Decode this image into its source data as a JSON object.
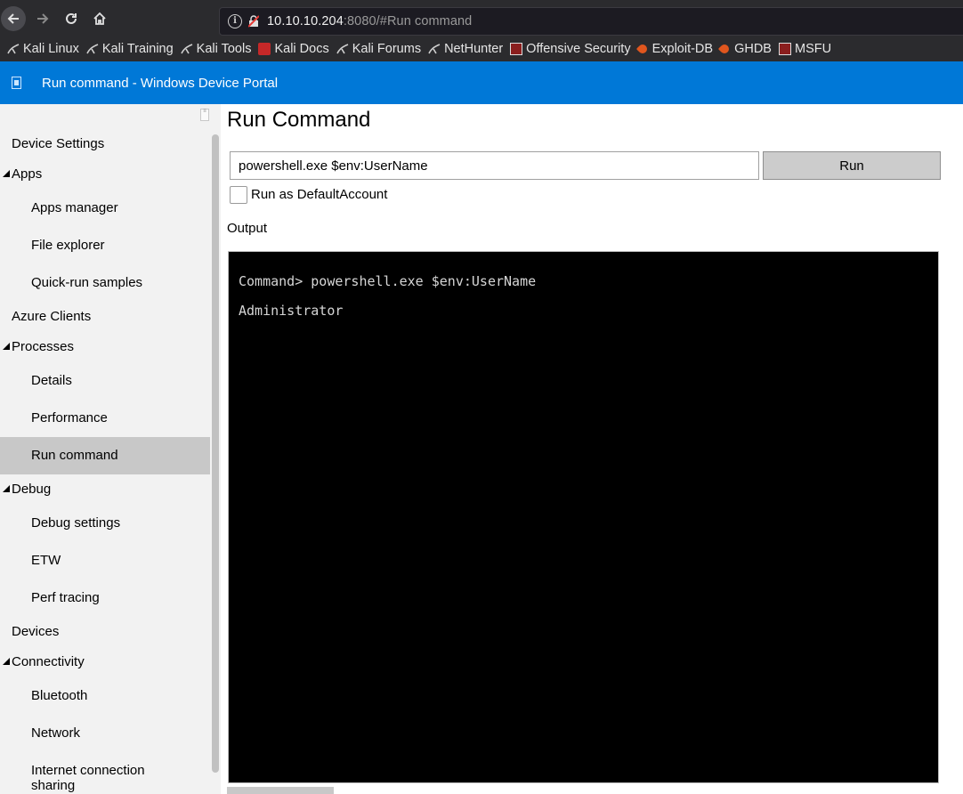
{
  "browser": {
    "url_host": "10.10.10.204",
    "url_rest": ":8080/#Run command",
    "bookmarks": [
      {
        "label": "Kali Linux",
        "icon": "kali-dragon-icon"
      },
      {
        "label": "Kali Training",
        "icon": "kali-dragon-icon"
      },
      {
        "label": "Kali Tools",
        "icon": "kali-dragon-icon"
      },
      {
        "label": "Kali Docs",
        "icon": "kali-docs-icon"
      },
      {
        "label": "Kali Forums",
        "icon": "kali-dragon-icon"
      },
      {
        "label": "NetHunter",
        "icon": "kali-dragon-icon"
      },
      {
        "label": "Offensive Security",
        "icon": "offsec-icon"
      },
      {
        "label": "Exploit-DB",
        "icon": "exploitdb-icon"
      },
      {
        "label": "GHDB",
        "icon": "exploitdb-icon"
      },
      {
        "label": "MSFU",
        "icon": "offsec-icon"
      }
    ]
  },
  "header": {
    "title": "Run command - Windows Device Portal",
    "color": "#0078d7"
  },
  "sidebar": {
    "items": [
      {
        "label": "Device Settings",
        "kind": "top"
      },
      {
        "label": "Apps",
        "kind": "group"
      },
      {
        "label": "Apps manager",
        "kind": "sub"
      },
      {
        "label": "File explorer",
        "kind": "sub"
      },
      {
        "label": "Quick-run samples",
        "kind": "sub"
      },
      {
        "label": "Azure Clients",
        "kind": "top"
      },
      {
        "label": "Processes",
        "kind": "group"
      },
      {
        "label": "Details",
        "kind": "sub"
      },
      {
        "label": "Performance",
        "kind": "sub"
      },
      {
        "label": "Run command",
        "kind": "sub",
        "active": true
      },
      {
        "label": "Debug",
        "kind": "group"
      },
      {
        "label": "Debug settings",
        "kind": "sub"
      },
      {
        "label": "ETW",
        "kind": "sub"
      },
      {
        "label": "Perf tracing",
        "kind": "sub"
      },
      {
        "label": "Devices",
        "kind": "top"
      },
      {
        "label": "Connectivity",
        "kind": "group"
      },
      {
        "label": "Bluetooth",
        "kind": "sub"
      },
      {
        "label": "Network",
        "kind": "sub"
      },
      {
        "label": "Internet connection sharing",
        "kind": "sub"
      }
    ]
  },
  "main": {
    "title": "Run Command",
    "command_value": "powershell.exe $env:UserName",
    "run_label": "Run",
    "checkbox_label": "Run as DefaultAccount",
    "checkbox_checked": false,
    "output_label": "Output",
    "output_lines": [
      "Command> powershell.exe $env:UserName",
      "Administrator"
    ]
  }
}
